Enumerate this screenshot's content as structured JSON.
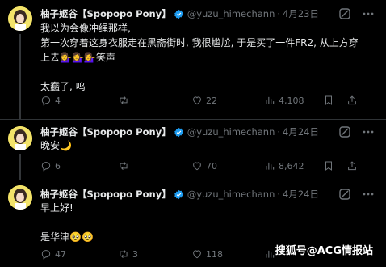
{
  "tweets": [
    {
      "display_name": "柚子姬谷【Spopopo Pony】",
      "handle": "@yuzu_himechann",
      "separator": "·",
      "date": "4月23日",
      "lines": [
        "我以为会像冲绳那样,",
        "第一次穿着这身衣服走在黑斋街时, 我很尴尬, 于是买了一件FR2, 从上方穿",
        "上去💁‍♀️💁‍♀️💁‍♀️笑声",
        "",
        "太蠢了, 呜"
      ],
      "actions": {
        "replies": "4",
        "retweets": "",
        "likes": "22",
        "views": "4,108"
      }
    },
    {
      "display_name": "柚子姬谷【Spopopo Pony】",
      "handle": "@yuzu_himechann",
      "separator": "·",
      "date": "4月24日",
      "lines": [
        "晚安🌙"
      ],
      "actions": {
        "replies": "6",
        "retweets": "",
        "likes": "70",
        "views": "8,642"
      }
    },
    {
      "display_name": "柚子姬谷【Spopopo Pony】",
      "handle": "@yuzu_himechann",
      "separator": "·",
      "date": "4月24日",
      "lines": [
        "早上好!",
        "",
        "是华津🥺🥺"
      ],
      "actions": {
        "replies": "47",
        "retweets": "3",
        "likes": "118",
        "views": ""
      }
    }
  ],
  "watermark": "搜狐号@ACG情报站",
  "colors": {
    "background": "#000000",
    "text_primary": "#e7e9ea",
    "text_secondary": "#71767b",
    "verified": "#1d9bf0",
    "divider": "#2f3336"
  },
  "icons": {
    "reply": "reply-icon",
    "retweet": "retweet-icon",
    "like": "heart-icon",
    "views": "views-chart-icon",
    "bookmark": "bookmark-icon",
    "share": "share-icon",
    "grok": "grok-icon",
    "more": "more-icon",
    "verified": "verified-badge-icon"
  }
}
